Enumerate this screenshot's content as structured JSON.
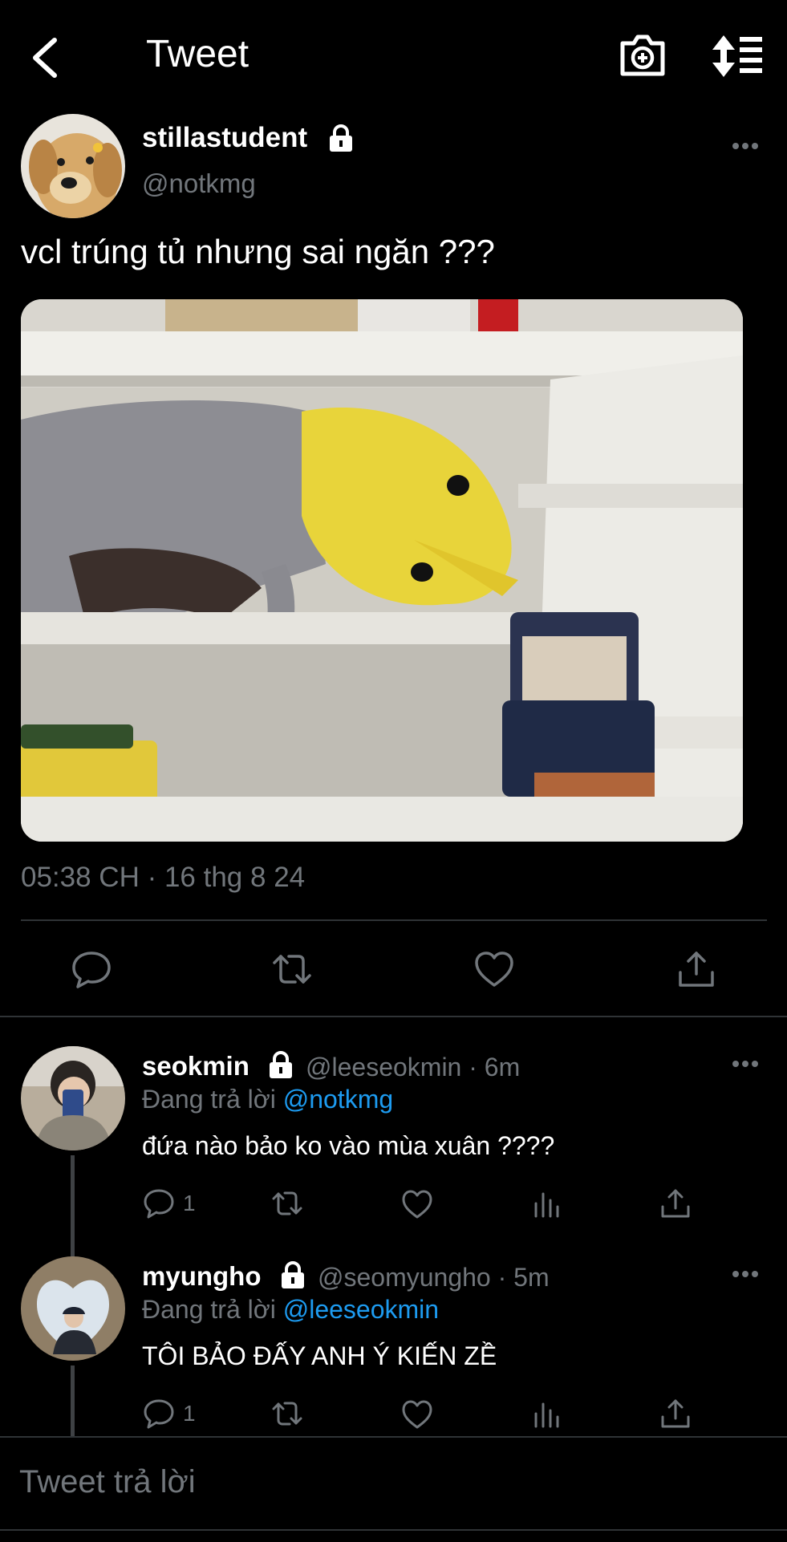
{
  "header": {
    "title": "Tweet"
  },
  "tweet": {
    "display_name": "stillastudent",
    "handle": "@notkmg",
    "text": "vcl trúng tủ nhưng sai ngăn ???",
    "timestamp": "05:38 CH · 16 thg 8 24"
  },
  "replies": [
    {
      "display_name": "seokmin",
      "handle": "@leeseokmin",
      "time": "· 6m",
      "replying_prefix": "Đang trả lời ",
      "replying_to": "@notkmg",
      "text": "đứa nào bảo ko vào mùa xuân ????",
      "reply_count": "1"
    },
    {
      "display_name": "myungho",
      "handle": "@seomyungho",
      "time": "· 5m",
      "replying_prefix": "Đang trả lời ",
      "replying_to": "@leeseokmin",
      "text": "TÔI BẢO ĐẤY ANH Ý KIẾN ZỀ",
      "reply_count": "1"
    }
  ],
  "composer": {
    "placeholder": "Tweet trả lời"
  },
  "colors": {
    "accent": "#1d9bf0",
    "muted": "#71767b",
    "divider": "#2f3336",
    "background": "#000000"
  }
}
